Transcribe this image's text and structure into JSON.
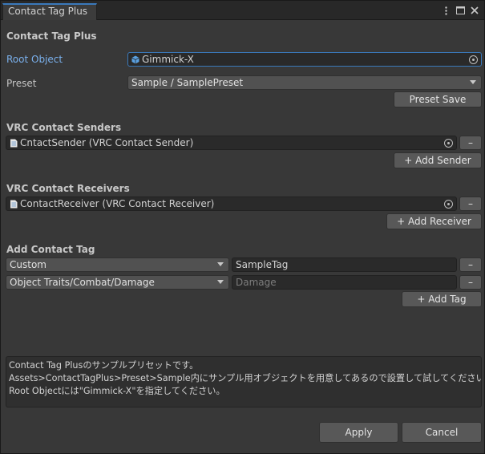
{
  "tab": {
    "title": "Contact Tag Plus"
  },
  "titlebar_icons": [
    "kebab-menu-icon",
    "maximize-icon",
    "close-icon"
  ],
  "header": {
    "title": "Contact Tag Plus"
  },
  "root_object": {
    "label": "Root Object",
    "value": "Gimmick-X"
  },
  "preset": {
    "label": "Preset",
    "selected": "Sample / SamplePreset",
    "save_label": "Preset Save"
  },
  "senders": {
    "heading": "VRC Contact Senders",
    "item": "CntactSender (VRC Contact Sender)",
    "remove_label": "–",
    "add_label": "+ Add Sender"
  },
  "receivers": {
    "heading": "VRC Contact Receivers",
    "item": "ContactReceiver (VRC Contact Receiver)",
    "remove_label": "–",
    "add_label": "+ Add Receiver"
  },
  "add_tag": {
    "heading": "Add Contact Tag",
    "rows": [
      {
        "type": "Custom",
        "value": "SampleTag",
        "placeholder": "",
        "remove_label": "–"
      },
      {
        "type": "Object Traits/Combat/Damage",
        "value": "",
        "placeholder": "Damage",
        "remove_label": "–"
      }
    ],
    "add_label": "+ Add Tag"
  },
  "help": {
    "lines": [
      "Contact Tag Plusのサンプルプリセットです。",
      "Assets>ContactTagPlus>Preset>Sample内にサンプル用オブジェクトを用意してあるので設置して試してください。",
      "Root Objectには\"Gimmick-X\"を指定してください。"
    ]
  },
  "footer": {
    "apply_label": "Apply",
    "cancel_label": "Cancel"
  },
  "colors": {
    "accent": "#3a79bb",
    "label_blue": "#7ab0ec",
    "background": "#383838"
  }
}
